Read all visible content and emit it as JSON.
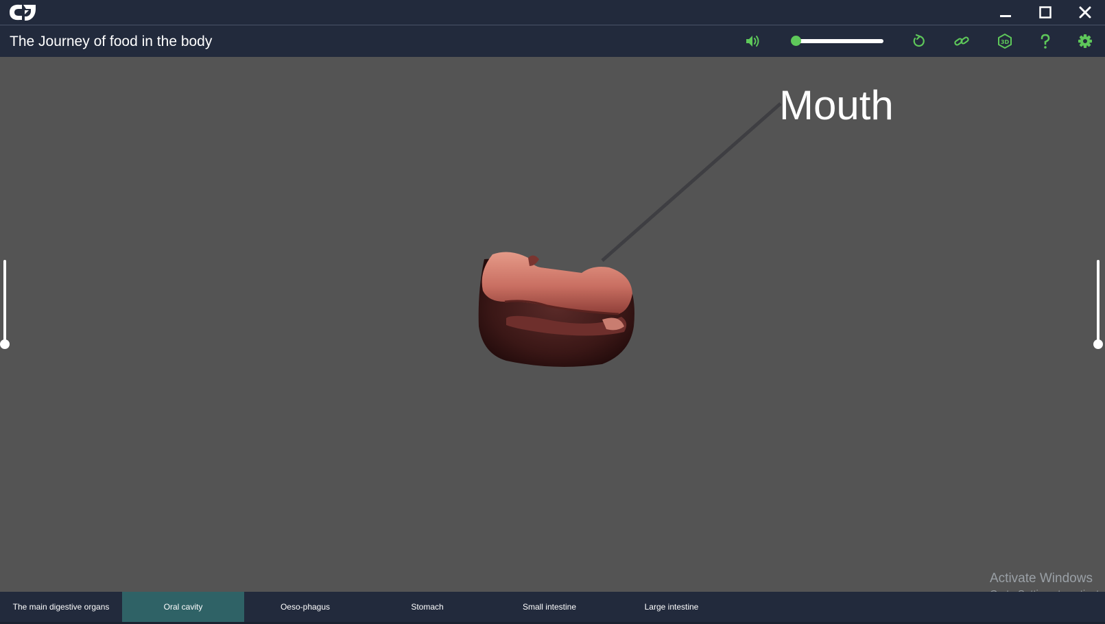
{
  "window": {
    "logo_icon": "app-logo-icon",
    "controls": [
      "minimize-icon",
      "maximize-icon",
      "close-icon"
    ]
  },
  "toolbar": {
    "title": "The Journey of food in the body",
    "icons": [
      "volume-icon",
      "reset-icon",
      "link-icon",
      "3d-view-icon",
      "help-icon",
      "settings-icon"
    ],
    "volume_level": 0.0
  },
  "viewport": {
    "label": "Mouth",
    "model": "3D mouth model"
  },
  "watermark": {
    "line1": "Activate Windows",
    "line2": "Go to Settings to activate"
  },
  "tabs": [
    {
      "label": "The main digestive organs",
      "active": false
    },
    {
      "label": "Oral cavity",
      "active": true
    },
    {
      "label": "Oeso-phagus",
      "active": false
    },
    {
      "label": "Stomach",
      "active": false
    },
    {
      "label": "Small intestine",
      "active": false
    },
    {
      "label": "Large intestine",
      "active": false
    }
  ],
  "colors": {
    "bar": "#222a3c",
    "background": "#545454",
    "accent": "#5ec85a",
    "active_tab": "#2f6266"
  }
}
